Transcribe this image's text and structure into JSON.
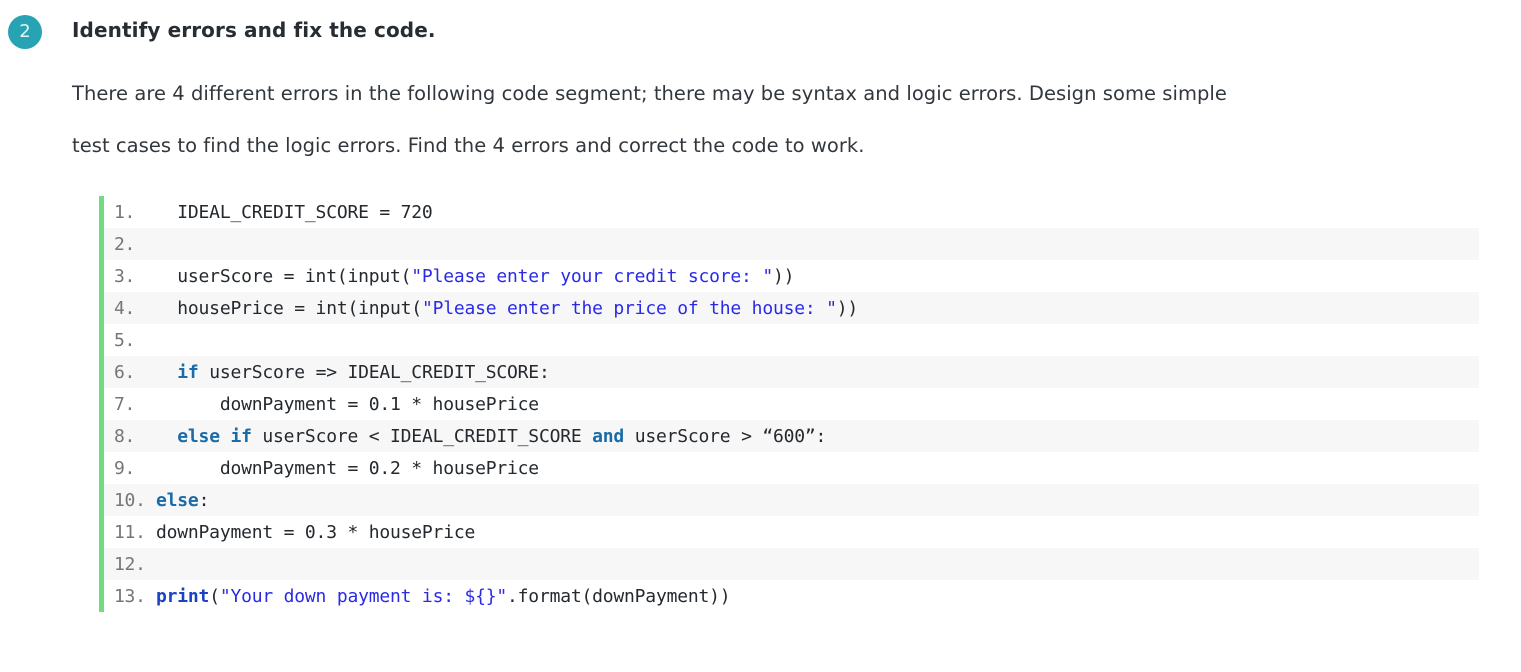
{
  "question": {
    "number": "2",
    "title": "Identify errors and fix the code.",
    "body_lines": [
      "There are 4 different errors in the following code segment; there may be syntax and logic errors. Design some simple",
      "test cases to find the logic errors. Find the 4 errors and correct the code to work."
    ]
  },
  "colors": {
    "badge_bg": "#27a3b4",
    "badge_text": "#e4f4f7",
    "code_accent_bar": "#6fdc82",
    "code_stripe": "#f7f7f8",
    "string_token": "#2a2ae6",
    "keyword_token": "#1a6ba8",
    "function_token": "#1b42c4",
    "heading_text": "#272d33"
  },
  "code": {
    "language": "python",
    "lines": [
      {
        "number": "1.",
        "shaded": false,
        "tokens": [
          {
            "t": "plain",
            "s": "  IDEAL_CREDIT_SCORE = 720"
          }
        ]
      },
      {
        "number": "2.",
        "shaded": true,
        "tokens": [
          {
            "t": "plain",
            "s": ""
          }
        ]
      },
      {
        "number": "3.",
        "shaded": false,
        "tokens": [
          {
            "t": "plain",
            "s": "  userScore = int(input("
          },
          {
            "t": "str",
            "s": "\"Please enter your credit score: \""
          },
          {
            "t": "plain",
            "s": "))"
          }
        ]
      },
      {
        "number": "4.",
        "shaded": true,
        "tokens": [
          {
            "t": "plain",
            "s": "  housePrice = int(input("
          },
          {
            "t": "str",
            "s": "\"Please enter the price of the house: \""
          },
          {
            "t": "plain",
            "s": "))"
          }
        ]
      },
      {
        "number": "5.",
        "shaded": false,
        "tokens": [
          {
            "t": "plain",
            "s": ""
          }
        ]
      },
      {
        "number": "6.",
        "shaded": true,
        "tokens": [
          {
            "t": "plain",
            "s": "  "
          },
          {
            "t": "kw",
            "s": "if"
          },
          {
            "t": "plain",
            "s": " userScore => IDEAL_CREDIT_SCORE:"
          }
        ]
      },
      {
        "number": "7.",
        "shaded": false,
        "tokens": [
          {
            "t": "plain",
            "s": "      downPayment = 0.1 * housePrice"
          }
        ]
      },
      {
        "number": "8.",
        "shaded": true,
        "tokens": [
          {
            "t": "plain",
            "s": "  "
          },
          {
            "t": "kw",
            "s": "else if"
          },
          {
            "t": "plain",
            "s": " userScore < IDEAL_CREDIT_SCORE "
          },
          {
            "t": "kw",
            "s": "and"
          },
          {
            "t": "plain",
            "s": " userScore > “600”:"
          }
        ]
      },
      {
        "number": "9.",
        "shaded": false,
        "tokens": [
          {
            "t": "plain",
            "s": "      downPayment = 0.2 * housePrice"
          }
        ]
      },
      {
        "number": "10.",
        "shaded": true,
        "tokens": [
          {
            "t": "kw",
            "s": "else"
          },
          {
            "t": "plain",
            "s": ":"
          }
        ]
      },
      {
        "number": "11.",
        "shaded": false,
        "tokens": [
          {
            "t": "plain",
            "s": "downPayment = 0.3 * housePrice"
          }
        ]
      },
      {
        "number": "12.",
        "shaded": true,
        "tokens": [
          {
            "t": "plain",
            "s": ""
          }
        ]
      },
      {
        "number": "13.",
        "shaded": false,
        "tokens": [
          {
            "t": "fn",
            "s": "print"
          },
          {
            "t": "plain",
            "s": "("
          },
          {
            "t": "str",
            "s": "\"Your down payment is: ${}\""
          },
          {
            "t": "plain",
            "s": ".format(downPayment))"
          }
        ]
      }
    ]
  }
}
